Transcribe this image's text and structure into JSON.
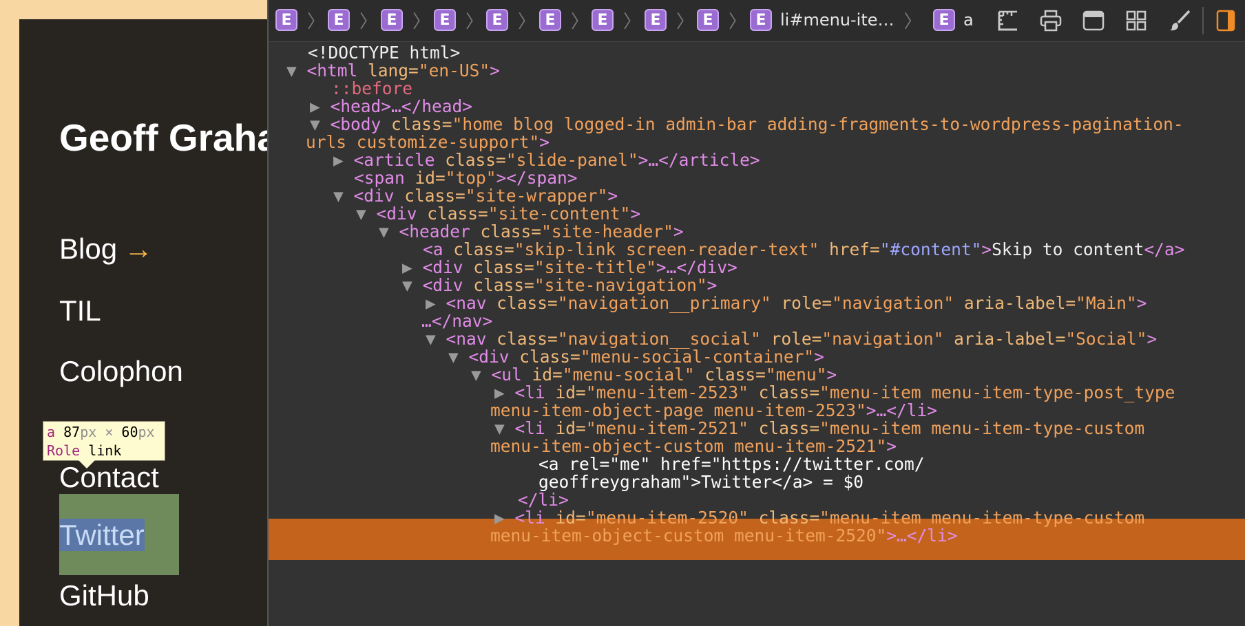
{
  "site": {
    "title": "Geoff Graham",
    "nav": {
      "blog": "Blog",
      "blog_arrow": "→",
      "til": "TIL",
      "colophon": "Colophon",
      "contact": "Contact",
      "twitter": "Twitter",
      "github": "GitHub"
    },
    "tooltip": {
      "tag": "a",
      "width_value": "87",
      "width_unit": "px",
      "times": "×",
      "height_value": "60",
      "height_unit": "px",
      "role_label": "Role",
      "role_value": "link"
    }
  },
  "devtools": {
    "breadcrumb": {
      "badge": "E",
      "separator": "〉",
      "item10": "li#menu-ite…",
      "item11": "a"
    },
    "toolbar_icons": [
      "ruler-icon",
      "print-icon",
      "window-icon",
      "grid-icon",
      "brush-icon",
      "panel-toggle-icon"
    ],
    "dom": {
      "l1": "<!DOCTYPE html>",
      "l2_tag": "<html",
      "l2_attr": " lang=",
      "l2_val": "\"en-US\"",
      "l2_end": ">",
      "l3": "::before",
      "l4": "<head>…</head>",
      "l5_tag": "<body",
      "l5_attr": " class=",
      "l5_val": "\"home blog logged-in admin-bar adding-fragments-to-wordpress-pagination-",
      "l6_val": "urls customize-support\"",
      "l6_end": ">",
      "l7_tag": "<article",
      "l7_attr": " class=",
      "l7_val": "\"slide-panel\"",
      "l7_end": ">…</article>",
      "l8_tag": "<span",
      "l8_attr": " id=",
      "l8_val": "\"top\"",
      "l8_end": "></span>",
      "l9_tag": "<div",
      "l9_attr": " class=",
      "l9_val": "\"site-wrapper\"",
      "l9_end": ">",
      "l10_tag": "<div",
      "l10_attr": " class=",
      "l10_val": "\"site-content\"",
      "l10_end": ">",
      "l11_tag": "<header",
      "l11_attr": " class=",
      "l11_val": "\"site-header\"",
      "l11_end": ">",
      "l12_tag": "<a",
      "l12_attr": " class=",
      "l12_val": "\"skip-link screen-reader-text\"",
      "l12_attr2": " href=",
      "l12_link": "\"#content\"",
      "l12_mid": ">",
      "l12_text": "Skip to content",
      "l12_end": "</a>",
      "l13_tag": "<div",
      "l13_attr": " class=",
      "l13_val": "\"site-title\"",
      "l13_end": ">…</div>",
      "l14_tag": "<div",
      "l14_attr": " class=",
      "l14_val": "\"site-navigation\"",
      "l14_end": ">",
      "l15_tag": "<nav",
      "l15_attr": " class=",
      "l15_val": "\"navigation__primary\"",
      "l15_attr2": " role=",
      "l15_val2": "\"navigation\"",
      "l15_attr3": " aria-label=",
      "l15_val3": "\"Main\"",
      "l15_end": ">",
      "l16": "…</nav>",
      "l17_tag": "<nav",
      "l17_attr": " class=",
      "l17_val": "\"navigation__social\"",
      "l17_attr2": " role=",
      "l17_val2": "\"navigation\"",
      "l17_attr3": " aria-label=",
      "l17_val3": "\"Social\"",
      "l17_end": ">",
      "l18_tag": "<div",
      "l18_attr": " class=",
      "l18_val": "\"menu-social-container\"",
      "l18_end": ">",
      "l19_tag": "<ul",
      "l19_attr": " id=",
      "l19_val": "\"menu-social\"",
      "l19_attr2": " class=",
      "l19_val2": "\"menu\"",
      "l19_end": ">",
      "l20_tag": "<li",
      "l20_attr": " id=",
      "l20_val": "\"menu-item-2523\"",
      "l20_attr2": " class=",
      "l20_val2": "\"menu-item menu-item-type-post_type",
      "l21_val": "menu-item-object-page menu-item-2523\"",
      "l21_end": ">…</li>",
      "l22_tag": "<li",
      "l22_attr": " id=",
      "l22_val": "\"menu-item-2521\"",
      "l22_attr2": " class=",
      "l22_val2": "\"menu-item menu-item-type-custom",
      "l23_val": "menu-item-object-custom menu-item-2521\"",
      "l23_end": ">",
      "l24": "<a rel=\"me\" href=\"https://twitter.com/",
      "l25": "geoffreygraham\">Twitter</a> = $0",
      "l26": "</li>",
      "l27_tag": "<li",
      "l27_attr": " id=",
      "l27_val": "\"menu-item-2520\"",
      "l27_attr2": " class=",
      "l27_val2": "\"menu-item menu-item-type-custom",
      "l28_val": "menu-item-object-custom menu-item-2520\"",
      "l28_end": ">…</li>"
    }
  }
}
